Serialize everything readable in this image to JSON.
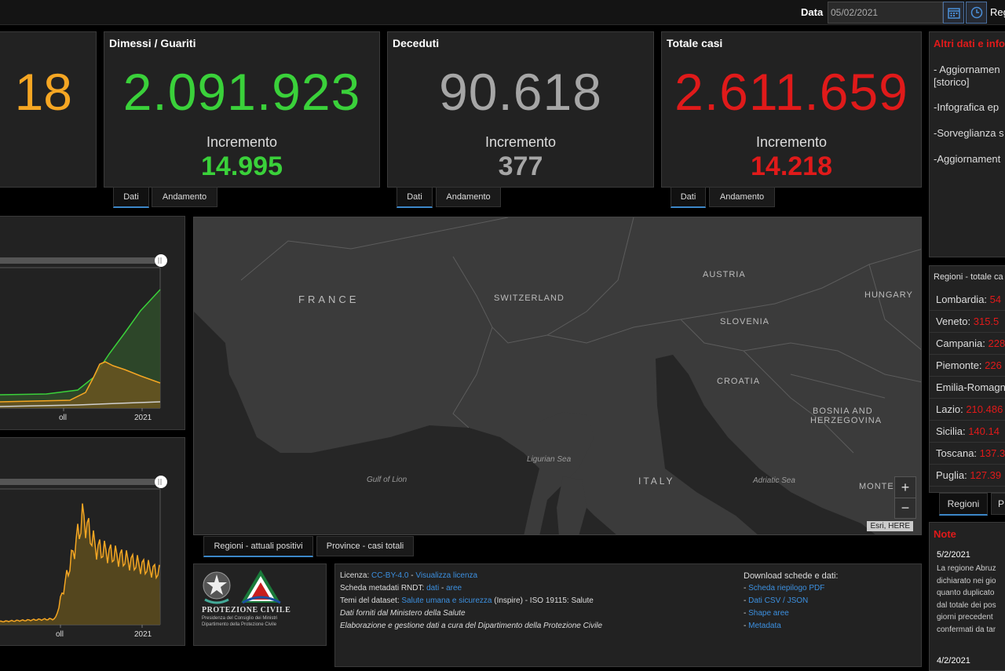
{
  "topbar": {
    "date_label": "Data",
    "date_value": "05/02/2021",
    "region_cut": "Reg",
    "calendar_icon": "calendar-icon",
    "clock_icon": "clock-icon"
  },
  "cards": {
    "positivi": {
      "number": "18",
      "color": "#f5a623"
    },
    "guariti": {
      "title": "Dimessi / Guariti",
      "number": "2.091.923",
      "inc_label": "Incremento",
      "inc": "14.995",
      "color": "#3ad13a"
    },
    "deceduti": {
      "title": "Deceduti",
      "number": "90.618",
      "inc_label": "Incremento",
      "inc": "377",
      "color": "#a6a6a6"
    },
    "totale": {
      "title": "Totale casi",
      "number": "2.611.659",
      "inc_label": "Incremento",
      "inc": "14.218",
      "color": "#e01a1a"
    }
  },
  "card_tabs": {
    "dati": "Dati",
    "andamento": "Andamento"
  },
  "altri": {
    "title": "Altri dati e info",
    "items": [
      "- Aggiornamen",
      "[storico]",
      "-Infografica ep",
      "-Sorveglianza s",
      "-Aggiornament"
    ]
  },
  "regioni": {
    "title": "Regioni - totale ca",
    "rows": [
      {
        "name": "Lombardia:",
        "value": "54"
      },
      {
        "name": "Veneto:",
        "value": "315.5"
      },
      {
        "name": "Campania:",
        "value": "228"
      },
      {
        "name": "Piemonte:",
        "value": "226"
      },
      {
        "name": "Emilia-Romagn",
        "value": ""
      },
      {
        "name": "Lazio:",
        "value": "210.486"
      },
      {
        "name": "Sicilia:",
        "value": "140.14"
      },
      {
        "name": "Toscana:",
        "value": "137.3"
      },
      {
        "name": "Puglia:",
        "value": "127.39"
      }
    ],
    "tab_regioni": "Regioni",
    "tab_p": "P"
  },
  "map": {
    "labels": {
      "france": "FRANCE",
      "switzerland": "SWITZERLAND",
      "austria": "AUSTRIA",
      "hungary": "HUNGARY",
      "slovenia": "SLOVENIA",
      "croatia": "CROATIA",
      "bosnia1": "BOSNIA AND",
      "bosnia2": "HERZEGOVINA",
      "italy": "ITALY",
      "montenegro": "MONTE"
    },
    "seas": {
      "ligurian": "Ligurian Sea",
      "lion": "Gulf of Lion",
      "adriatic": "Adriatic Sea"
    },
    "attribution": "Esri, HERE",
    "zoom_in": "+",
    "zoom_out": "−",
    "tab_regioni": "Regioni - attuali positivi",
    "tab_province": "Province - casi totali"
  },
  "chart1": {
    "xlabels": [
      "oll",
      "2021"
    ]
  },
  "chart2": {
    "xlabels": [
      "oll",
      "2021"
    ]
  },
  "logo": {
    "name": "PROTEZIONE CIVILE",
    "sub1": "Presidenza del Consiglio dei Ministri",
    "sub2": "Dipartimento della Protezione Civile"
  },
  "footer": {
    "lic_label": "Licenza:",
    "lic_link": "CC-BY-4.0",
    "lic_sep": " - ",
    "lic_view": "Visualizza licenza",
    "meta_label": "Scheda metadati RNDT:",
    "meta_dati": "dati",
    "meta_sep": " - ",
    "meta_aree": "aree",
    "temi_label": "Temi del dataset:",
    "temi_link": "Salute umana e sicurezza",
    "temi_rest": "(Inspire) - ISO 19115: Salute",
    "line4": "Dati forniti dal Ministero della Salute",
    "line5": "Elaborazione e gestione dati a cura del Dipartimento della Protezione Civile",
    "dl_title": "Download schede e dati:",
    "dl_items": [
      "Scheda riepilogo PDF",
      "Dati CSV / JSON",
      "Shape aree",
      "Metadata"
    ]
  },
  "note": {
    "title": "Note",
    "date1": "5/2/2021",
    "lines": [
      "La regione Abruz",
      "dichiarato nei gio",
      "quanto duplicato",
      "dal totale dei pos",
      "giorni precedent",
      "confermati da tar"
    ],
    "date2": "4/2/2021"
  }
}
